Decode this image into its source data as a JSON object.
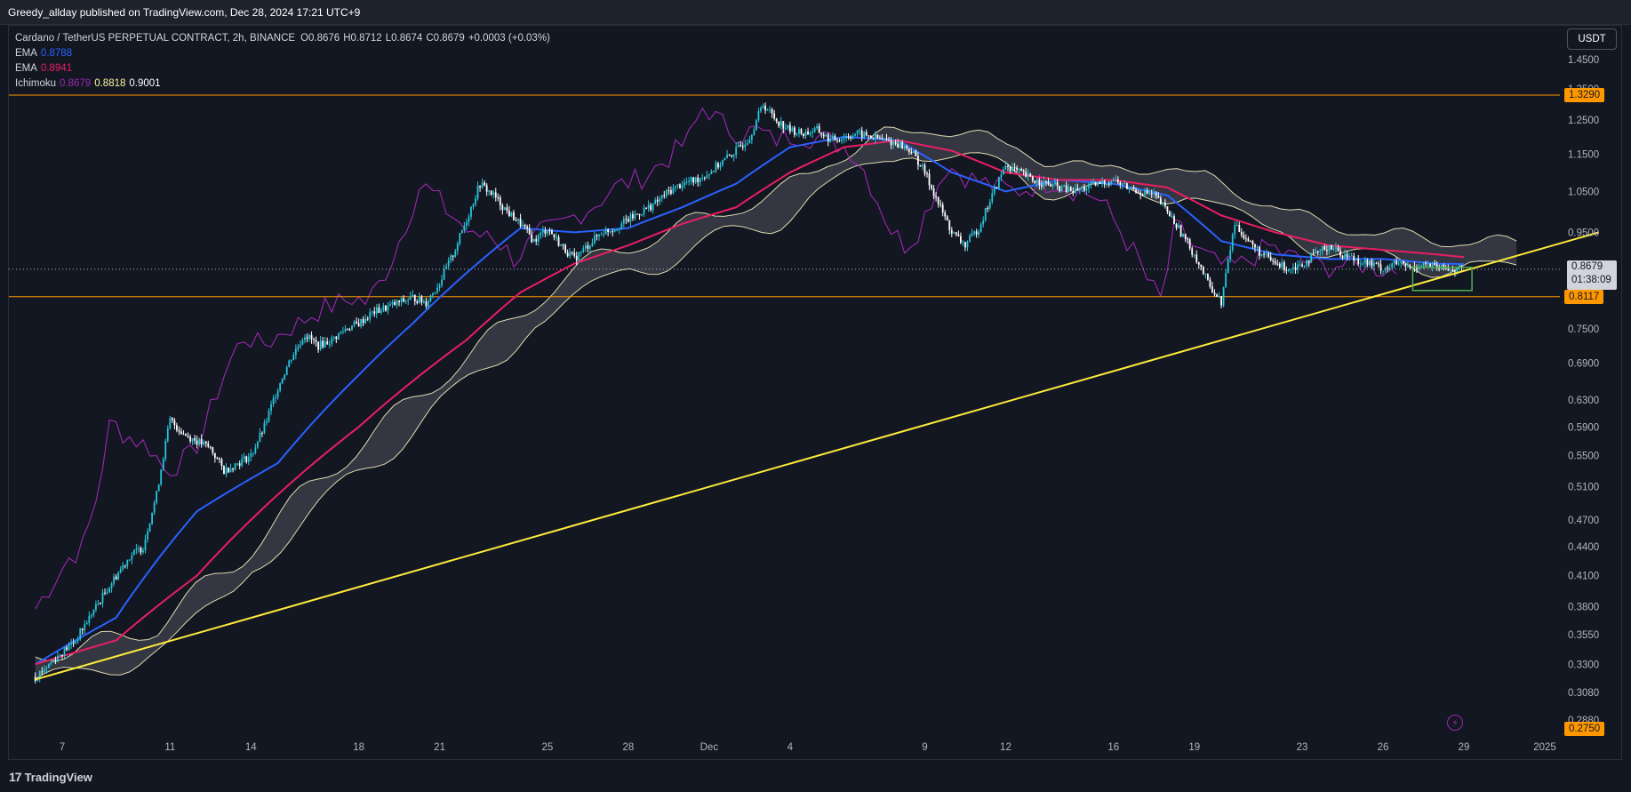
{
  "header": {
    "publish_text": "Greedy_allday published on TradingView.com, Dec 28, 2024 17:21 UTC+9"
  },
  "legend": {
    "symbol": "Cardano / TetherUS PERPETUAL CONTRACT, 2h, BINANCE",
    "ohlc": {
      "o_label": "O",
      "o": "0.8676",
      "h_label": "H",
      "h": "0.8712",
      "l_label": "L",
      "l": "0.8674",
      "c_label": "C",
      "c": "0.8679",
      "change": "+0.0003 (+0.03%)"
    },
    "ema1": {
      "name": "EMA",
      "value": "0.8788",
      "color": "#2962ff"
    },
    "ema2": {
      "name": "EMA",
      "value": "0.8941",
      "color": "#e91e63"
    },
    "ichimoku": {
      "name": "Ichimoku",
      "values": [
        "0.8679",
        "0.8818",
        "0.9001"
      ],
      "colors": [
        "#9c27b0",
        "#fff59d",
        "#ffffff"
      ]
    }
  },
  "currency": "USDT",
  "price_tags": {
    "upper_line": "1.3290",
    "lower_line": "0.8117",
    "last_price": "0.8679",
    "countdown": "01:38:09",
    "bottom": "0.2750"
  },
  "footer": {
    "brand": "TradingView",
    "logo_mark": "17"
  },
  "colors": {
    "background": "#131722",
    "candle_up": "#26c6da",
    "candle_down": "#ffffff",
    "ema_fast": "#2962ff",
    "ema_slow": "#e91e63",
    "chikou": "#9c27b0",
    "cloud_edge": "#fff9c4",
    "trendline": "#ffeb3b",
    "horizontal_lines": "#ff9800",
    "box": "#4caf50"
  },
  "chart_data": {
    "type": "line",
    "title": "Cardano / TetherUS PERPETUAL CONTRACT, 2h, BINANCE",
    "y_scale": "log",
    "ylim": [
      0.275,
      1.45
    ],
    "y_ticks": [
      "1.4500",
      "1.3500",
      "1.2500",
      "1.1500",
      "1.0500",
      "0.9500",
      "0.7500",
      "0.6900",
      "0.6300",
      "0.5900",
      "0.5500",
      "0.5100",
      "0.4700",
      "0.4400",
      "0.4100",
      "0.3800",
      "0.3550",
      "0.3300",
      "0.3080",
      "0.2880"
    ],
    "x_ticks": [
      "7",
      "11",
      "14",
      "18",
      "21",
      "25",
      "28",
      "Dec",
      "4",
      "9",
      "12",
      "16",
      "19",
      "23",
      "26",
      "29",
      "2025"
    ],
    "x_tick_days": [
      7,
      11,
      14,
      18,
      21,
      25,
      28,
      31,
      34,
      39,
      42,
      46,
      49,
      53,
      56,
      59,
      62
    ],
    "series": [
      {
        "name": "Price",
        "days": [
          6.0,
          6.5,
          7.0,
          7.5,
          8.0,
          8.5,
          9.0,
          9.5,
          10.0,
          10.5,
          11.0,
          11.5,
          12.0,
          12.5,
          13.0,
          13.5,
          14.0,
          14.5,
          15.0,
          15.5,
          16.0,
          16.5,
          17.0,
          17.5,
          18.0,
          18.5,
          19.0,
          19.5,
          20.0,
          20.5,
          21.0,
          21.5,
          22.0,
          22.5,
          23.0,
          23.5,
          24.0,
          24.5,
          25.0,
          25.5,
          26.0,
          26.5,
          27.0,
          27.5,
          28.0,
          28.5,
          29.0,
          29.5,
          30.0,
          30.5,
          31.0,
          31.5,
          32.0,
          32.5,
          33.0,
          33.5,
          34.0,
          34.5,
          35.0,
          35.5,
          36.0,
          36.5,
          37.0,
          37.5,
          38.0,
          38.5,
          39.0,
          39.5,
          40.0,
          40.5,
          41.0,
          41.5,
          42.0,
          42.5,
          43.0,
          43.5,
          44.0,
          44.5,
          45.0,
          45.5,
          46.0,
          46.5,
          47.0,
          47.5,
          48.0,
          48.5,
          49.0,
          49.5,
          50.0,
          50.5,
          51.0,
          51.5,
          52.0,
          52.5,
          53.0,
          53.5,
          54.0,
          54.5,
          55.0,
          55.5,
          56.0,
          56.5,
          57.0,
          57.5,
          58.0,
          58.5,
          59.0
        ],
        "values": [
          0.32,
          0.33,
          0.34,
          0.35,
          0.37,
          0.39,
          0.41,
          0.43,
          0.44,
          0.5,
          0.6,
          0.58,
          0.57,
          0.56,
          0.53,
          0.54,
          0.55,
          0.59,
          0.65,
          0.7,
          0.74,
          0.72,
          0.73,
          0.75,
          0.76,
          0.78,
          0.79,
          0.8,
          0.81,
          0.8,
          0.84,
          0.9,
          0.98,
          1.07,
          1.04,
          1.0,
          0.97,
          0.93,
          0.96,
          0.92,
          0.89,
          0.92,
          0.95,
          0.96,
          0.98,
          1.0,
          1.02,
          1.05,
          1.07,
          1.08,
          1.1,
          1.13,
          1.16,
          1.2,
          1.3,
          1.25,
          1.22,
          1.21,
          1.22,
          1.19,
          1.2,
          1.21,
          1.2,
          1.19,
          1.18,
          1.16,
          1.1,
          1.02,
          0.95,
          0.92,
          0.96,
          1.04,
          1.12,
          1.1,
          1.08,
          1.07,
          1.06,
          1.05,
          1.06,
          1.07,
          1.08,
          1.06,
          1.05,
          1.04,
          1.0,
          0.95,
          0.9,
          0.84,
          0.8,
          0.97,
          0.93,
          0.9,
          0.88,
          0.87,
          0.88,
          0.9,
          0.92,
          0.9,
          0.89,
          0.88,
          0.87,
          0.88,
          0.87,
          0.88,
          0.87,
          0.868,
          0.8679
        ]
      },
      {
        "name": "EMA 0.8788",
        "days": [
          6,
          9,
          12,
          15,
          18,
          20,
          22,
          24,
          26,
          28,
          30,
          32,
          34,
          36,
          38,
          40,
          42,
          44,
          46,
          48,
          50,
          52,
          54,
          56,
          58,
          59
        ],
        "values": [
          0.33,
          0.37,
          0.48,
          0.54,
          0.67,
          0.76,
          0.86,
          0.96,
          0.95,
          0.96,
          1.01,
          1.07,
          1.17,
          1.2,
          1.19,
          1.1,
          1.05,
          1.08,
          1.07,
          1.04,
          0.93,
          0.9,
          0.89,
          0.89,
          0.88,
          0.879
        ]
      },
      {
        "name": "EMA 0.8941",
        "days": [
          6,
          9,
          12,
          15,
          18,
          20,
          22,
          24,
          26,
          28,
          30,
          32,
          34,
          36,
          38,
          40,
          42,
          44,
          46,
          48,
          50,
          52,
          54,
          56,
          58,
          59
        ],
        "values": [
          0.33,
          0.35,
          0.41,
          0.5,
          0.59,
          0.66,
          0.73,
          0.82,
          0.88,
          0.92,
          0.97,
          1.01,
          1.1,
          1.17,
          1.19,
          1.16,
          1.1,
          1.08,
          1.08,
          1.06,
          0.99,
          0.95,
          0.92,
          0.91,
          0.9,
          0.894
        ]
      }
    ],
    "horizontal_lines": [
      1.329,
      0.8117
    ],
    "trendline": {
      "from": {
        "day": 6.0,
        "price": 0.318
      },
      "to": {
        "day": 64.0,
        "price": 0.95
      }
    }
  }
}
